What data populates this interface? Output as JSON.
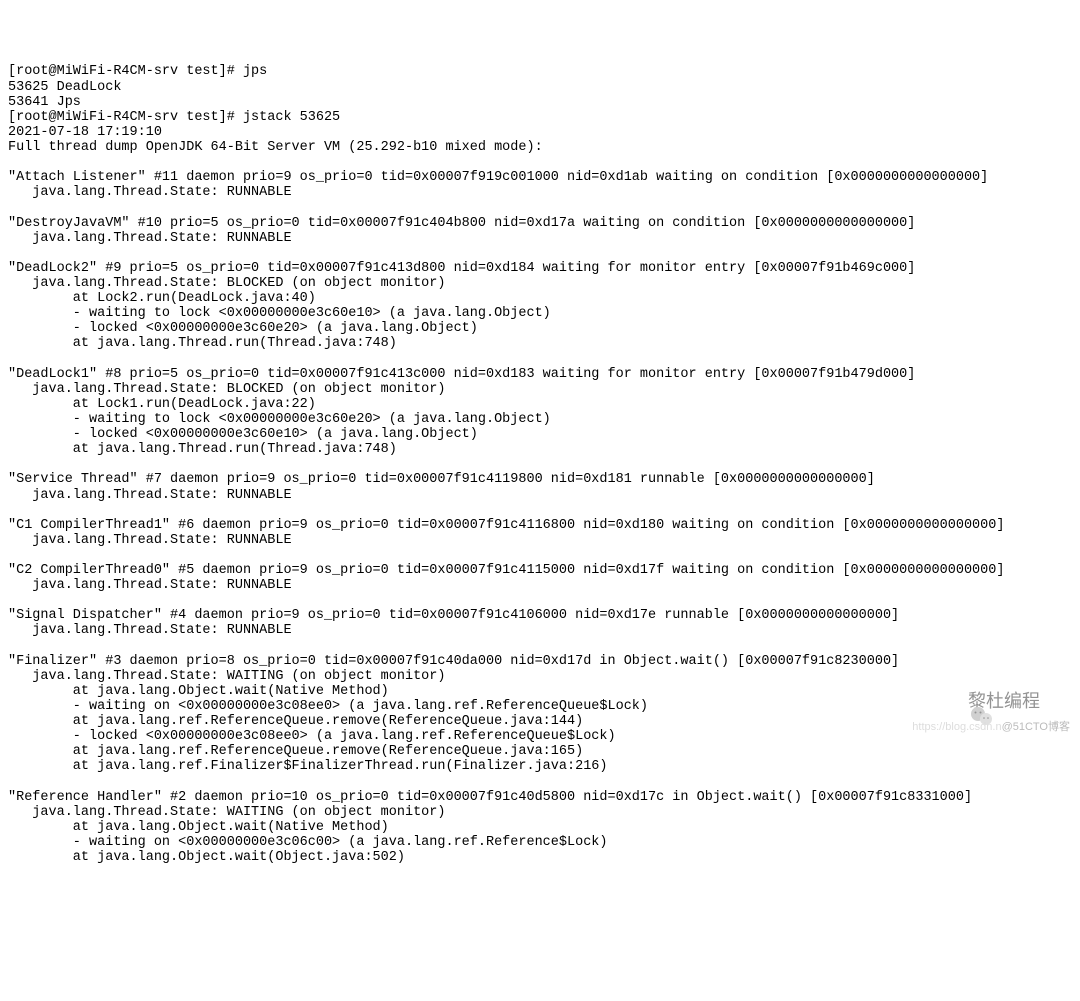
{
  "lines": [
    "[root@MiWiFi-R4CM-srv test]# jps",
    "53625 DeadLock",
    "53641 Jps",
    "[root@MiWiFi-R4CM-srv test]# jstack 53625",
    "2021-07-18 17:19:10",
    "Full thread dump OpenJDK 64-Bit Server VM (25.292-b10 mixed mode):",
    "",
    "\"Attach Listener\" #11 daemon prio=9 os_prio=0 tid=0x00007f919c001000 nid=0xd1ab waiting on condition [0x0000000000000000]",
    "   java.lang.Thread.State: RUNNABLE",
    "",
    "\"DestroyJavaVM\" #10 prio=5 os_prio=0 tid=0x00007f91c404b800 nid=0xd17a waiting on condition [0x0000000000000000]",
    "   java.lang.Thread.State: RUNNABLE",
    "",
    "\"DeadLock2\" #9 prio=5 os_prio=0 tid=0x00007f91c413d800 nid=0xd184 waiting for monitor entry [0x00007f91b469c000]",
    "   java.lang.Thread.State: BLOCKED (on object monitor)",
    "        at Lock2.run(DeadLock.java:40)",
    "        - waiting to lock <0x00000000e3c60e10> (a java.lang.Object)",
    "        - locked <0x00000000e3c60e20> (a java.lang.Object)",
    "        at java.lang.Thread.run(Thread.java:748)",
    "",
    "\"DeadLock1\" #8 prio=5 os_prio=0 tid=0x00007f91c413c000 nid=0xd183 waiting for monitor entry [0x00007f91b479d000]",
    "   java.lang.Thread.State: BLOCKED (on object monitor)",
    "        at Lock1.run(DeadLock.java:22)",
    "        - waiting to lock <0x00000000e3c60e20> (a java.lang.Object)",
    "        - locked <0x00000000e3c60e10> (a java.lang.Object)",
    "        at java.lang.Thread.run(Thread.java:748)",
    "",
    "\"Service Thread\" #7 daemon prio=9 os_prio=0 tid=0x00007f91c4119800 nid=0xd181 runnable [0x0000000000000000]",
    "   java.lang.Thread.State: RUNNABLE",
    "",
    "\"C1 CompilerThread1\" #6 daemon prio=9 os_prio=0 tid=0x00007f91c4116800 nid=0xd180 waiting on condition [0x0000000000000000]",
    "   java.lang.Thread.State: RUNNABLE",
    "",
    "\"C2 CompilerThread0\" #5 daemon prio=9 os_prio=0 tid=0x00007f91c4115000 nid=0xd17f waiting on condition [0x0000000000000000]",
    "   java.lang.Thread.State: RUNNABLE",
    "",
    "\"Signal Dispatcher\" #4 daemon prio=9 os_prio=0 tid=0x00007f91c4106000 nid=0xd17e runnable [0x0000000000000000]",
    "   java.lang.Thread.State: RUNNABLE",
    "",
    "\"Finalizer\" #3 daemon prio=8 os_prio=0 tid=0x00007f91c40da000 nid=0xd17d in Object.wait() [0x00007f91c8230000]",
    "   java.lang.Thread.State: WAITING (on object monitor)",
    "        at java.lang.Object.wait(Native Method)",
    "        - waiting on <0x00000000e3c08ee0> (a java.lang.ref.ReferenceQueue$Lock)",
    "        at java.lang.ref.ReferenceQueue.remove(ReferenceQueue.java:144)",
    "        - locked <0x00000000e3c08ee0> (a java.lang.ref.ReferenceQueue$Lock)",
    "        at java.lang.ref.ReferenceQueue.remove(ReferenceQueue.java:165)",
    "        at java.lang.ref.Finalizer$FinalizerThread.run(Finalizer.java:216)",
    "",
    "\"Reference Handler\" #2 daemon prio=10 os_prio=0 tid=0x00007f91c40d5800 nid=0xd17c in Object.wait() [0x00007f91c8331000]",
    "   java.lang.Thread.State: WAITING (on object monitor)",
    "        at java.lang.Object.wait(Native Method)",
    "        - waiting on <0x00000000e3c06c00> (a java.lang.ref.Reference$Lock)",
    "        at java.lang.Object.wait(Object.java:502)"
  ],
  "watermark": {
    "text1": "黎杜编程",
    "text2_light": "https://blog.csdn.n",
    "text2": "@51CTO博客"
  }
}
